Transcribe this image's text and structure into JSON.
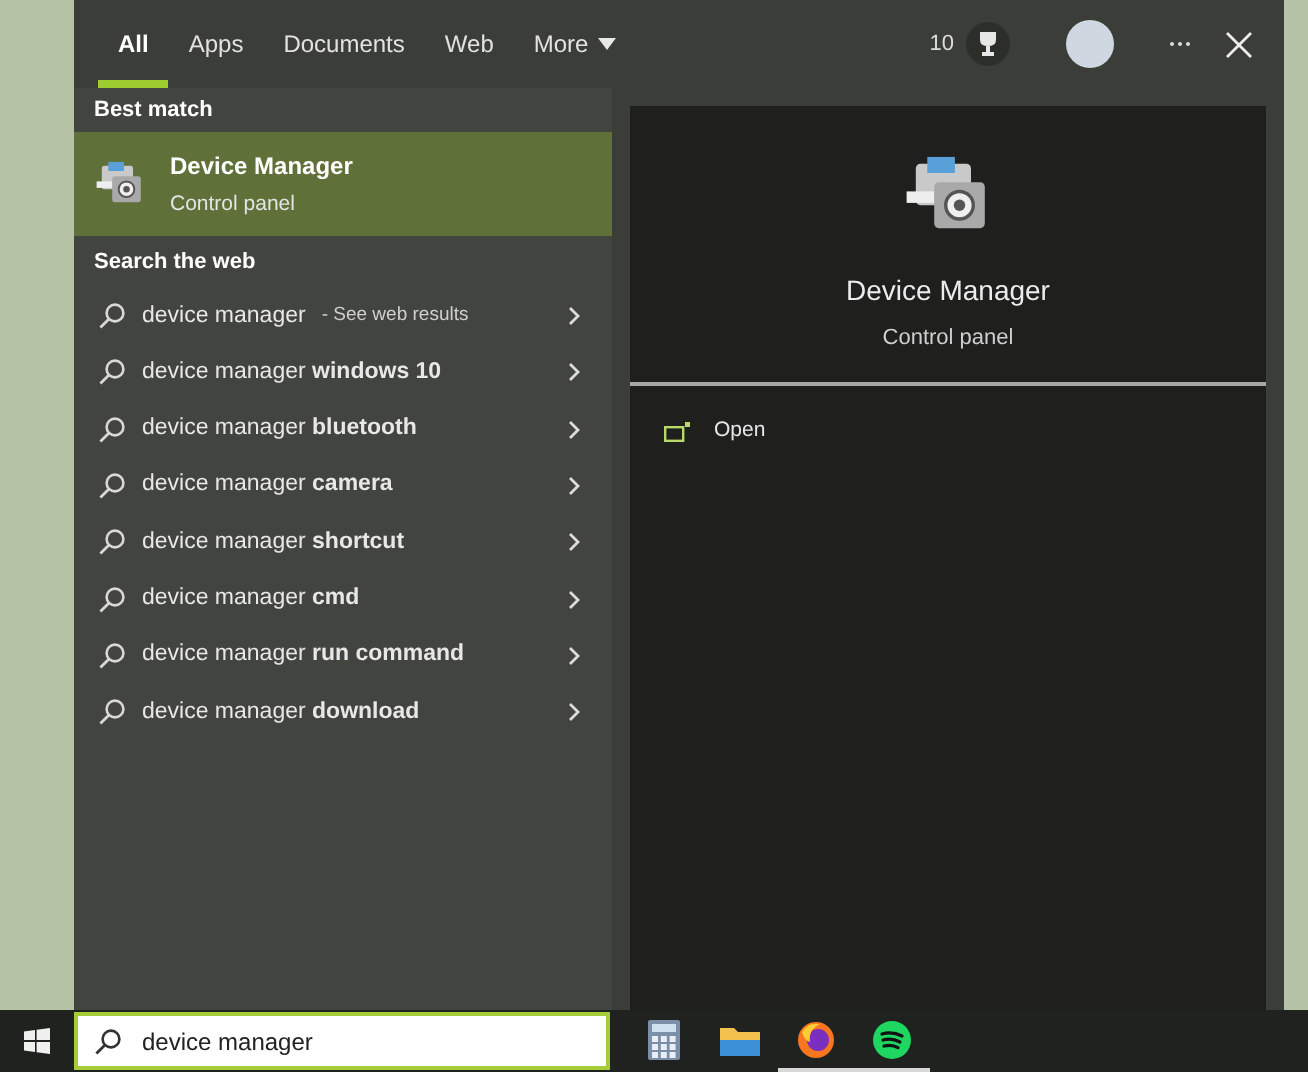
{
  "tabs": [
    {
      "label": "All",
      "selected": true,
      "dropdown": false
    },
    {
      "label": "Apps",
      "selected": false,
      "dropdown": false
    },
    {
      "label": "Documents",
      "selected": false,
      "dropdown": false
    },
    {
      "label": "Web",
      "selected": false,
      "dropdown": false
    },
    {
      "label": "More",
      "selected": false,
      "dropdown": true
    }
  ],
  "rewards_points": "10",
  "best_match": {
    "heading": "Best match",
    "title": "Device Manager",
    "subtitle": "Control panel",
    "selected": true
  },
  "web_section": {
    "heading": "Search the web",
    "items": [
      {
        "text": "device manager",
        "hint": "- See web results"
      },
      {
        "text": "device manager **windows 10**"
      },
      {
        "text": "device manager **bluetooth**"
      },
      {
        "text": "device manager **camera**"
      },
      {
        "text": "device manager **shortcut**"
      },
      {
        "text": "device manager **cmd**"
      },
      {
        "text": "device manager **run command**"
      },
      {
        "text": "device manager **download**"
      }
    ]
  },
  "preview": {
    "title": "Device Manager",
    "subtitle": "Control panel",
    "actions": [
      {
        "label": "Open"
      }
    ]
  },
  "taskbar": {
    "search_value": "device manager",
    "apps": [
      {
        "kind": "calculator",
        "running": false
      },
      {
        "kind": "folder",
        "running": false
      },
      {
        "kind": "browser",
        "running": true
      },
      {
        "kind": "music",
        "running": true
      }
    ]
  }
}
